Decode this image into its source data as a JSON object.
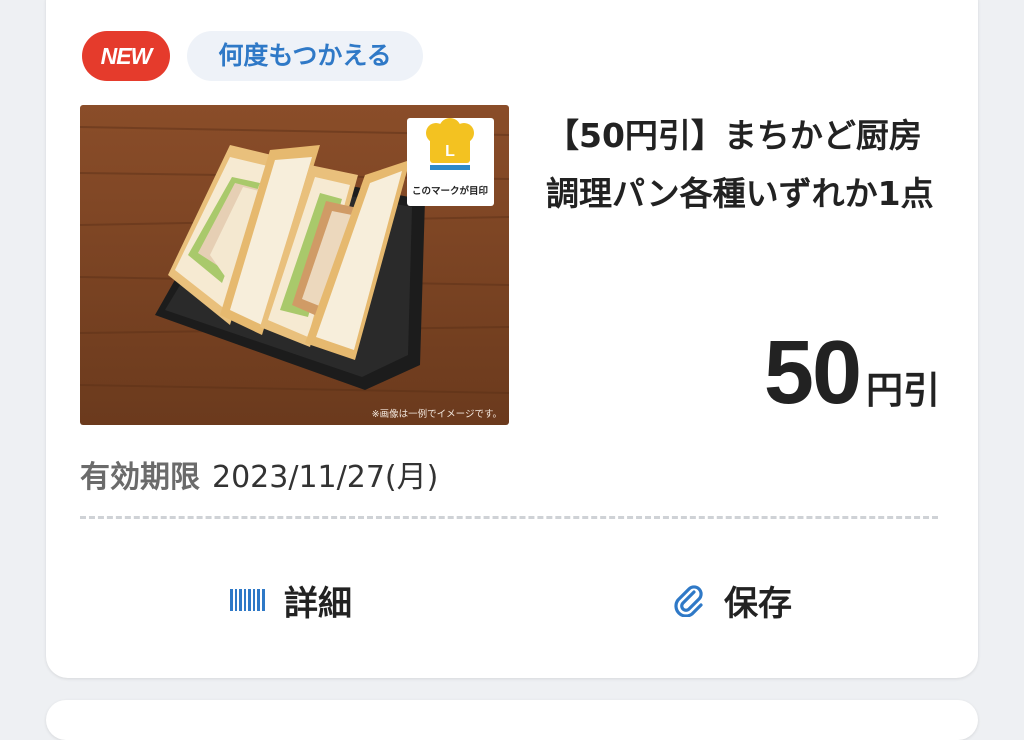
{
  "badges": {
    "new": "NEW",
    "reuse": "何度もつかえる"
  },
  "photo": {
    "mark_caption": "このマークが目印",
    "mark_letter": "L",
    "disclaimer": "※画像は一例でイメージです。"
  },
  "coupon": {
    "title": "【50円引】まちかど厨房 調理パン各種いずれか1点",
    "amount_number": "50",
    "amount_unit": "円引",
    "expiry_label": "有効期限",
    "expiry_value": "2023/11/27(月)"
  },
  "actions": {
    "details_label": "詳細",
    "save_label": "保存",
    "details_icon": "barcode-icon",
    "save_icon": "paperclip-icon"
  },
  "colors": {
    "new_badge": "#e53b2c",
    "reuse_badge_bg": "#eef2f8",
    "reuse_badge_text": "#2f79c7",
    "icon_blue": "#2f79c7"
  }
}
